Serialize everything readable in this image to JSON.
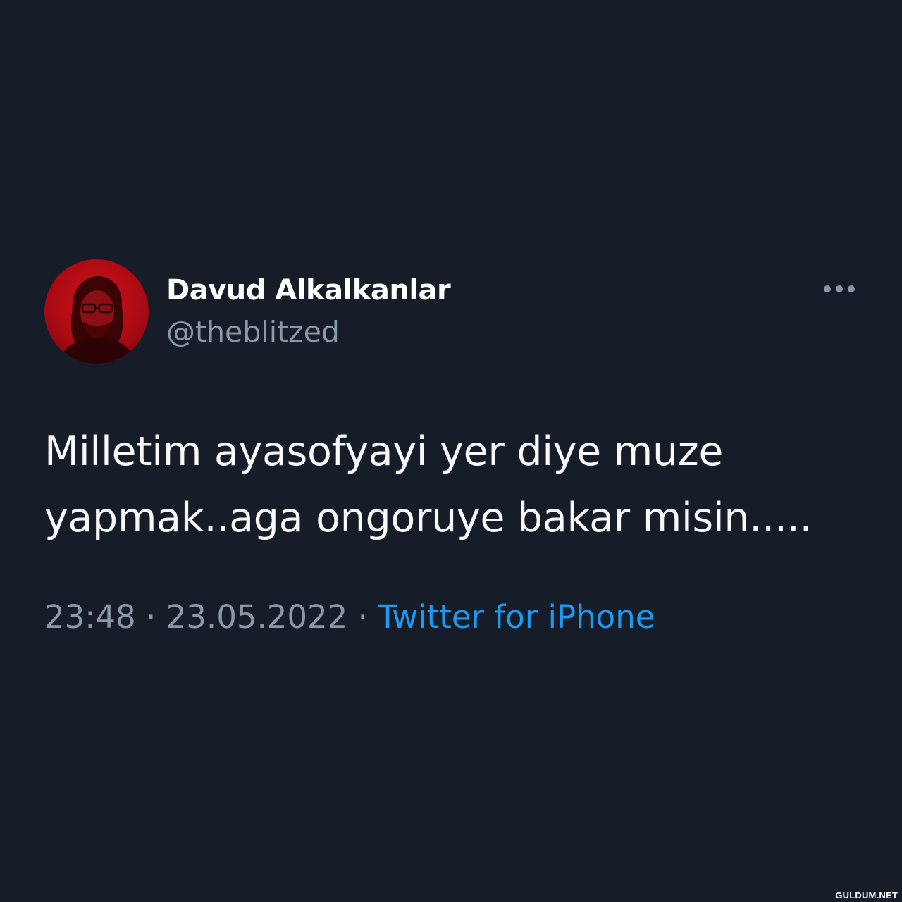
{
  "tweet": {
    "author": {
      "display_name": "Davud Alkalkanlar",
      "handle": "@theblitzed",
      "avatar_icon": "profile-photo-red-tint"
    },
    "more_icon": "more-dots-icon",
    "text_lines": [
      "Milletim ayasofyayi yer diye muze",
      "yapmak..aga ongoruye bakar misin....."
    ],
    "time": "23:48",
    "separator": "·",
    "date": "23.05.2022",
    "source": "Twitter for iPhone"
  },
  "watermark": "GULDUM.NET",
  "colors": {
    "background": "#161d29",
    "primary_text": "#f7f9f9",
    "secondary_text": "#8b98a5",
    "link": "#1d9bf0"
  }
}
